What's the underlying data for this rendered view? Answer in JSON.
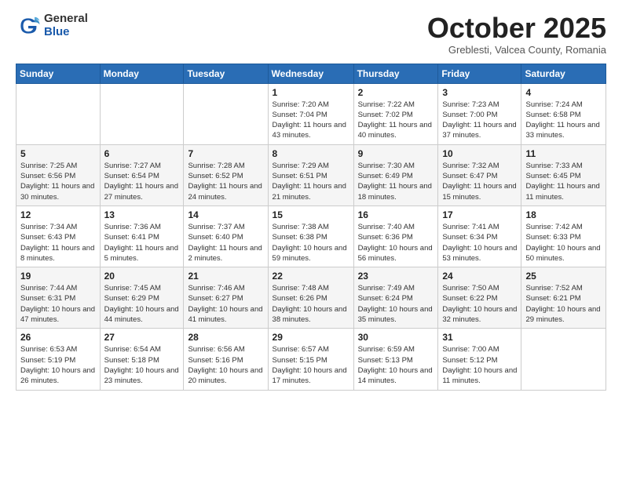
{
  "header": {
    "logo": {
      "general": "General",
      "blue": "Blue"
    },
    "title": "October 2025",
    "subtitle": "Greblesti, Valcea County, Romania"
  },
  "weekdays": [
    "Sunday",
    "Monday",
    "Tuesday",
    "Wednesday",
    "Thursday",
    "Friday",
    "Saturday"
  ],
  "weeks": [
    [
      {
        "day": null
      },
      {
        "day": null
      },
      {
        "day": null
      },
      {
        "day": 1,
        "sunrise": "Sunrise: 7:20 AM",
        "sunset": "Sunset: 7:04 PM",
        "daylight": "Daylight: 11 hours and 43 minutes."
      },
      {
        "day": 2,
        "sunrise": "Sunrise: 7:22 AM",
        "sunset": "Sunset: 7:02 PM",
        "daylight": "Daylight: 11 hours and 40 minutes."
      },
      {
        "day": 3,
        "sunrise": "Sunrise: 7:23 AM",
        "sunset": "Sunset: 7:00 PM",
        "daylight": "Daylight: 11 hours and 37 minutes."
      },
      {
        "day": 4,
        "sunrise": "Sunrise: 7:24 AM",
        "sunset": "Sunset: 6:58 PM",
        "daylight": "Daylight: 11 hours and 33 minutes."
      }
    ],
    [
      {
        "day": 5,
        "sunrise": "Sunrise: 7:25 AM",
        "sunset": "Sunset: 6:56 PM",
        "daylight": "Daylight: 11 hours and 30 minutes."
      },
      {
        "day": 6,
        "sunrise": "Sunrise: 7:27 AM",
        "sunset": "Sunset: 6:54 PM",
        "daylight": "Daylight: 11 hours and 27 minutes."
      },
      {
        "day": 7,
        "sunrise": "Sunrise: 7:28 AM",
        "sunset": "Sunset: 6:52 PM",
        "daylight": "Daylight: 11 hours and 24 minutes."
      },
      {
        "day": 8,
        "sunrise": "Sunrise: 7:29 AM",
        "sunset": "Sunset: 6:51 PM",
        "daylight": "Daylight: 11 hours and 21 minutes."
      },
      {
        "day": 9,
        "sunrise": "Sunrise: 7:30 AM",
        "sunset": "Sunset: 6:49 PM",
        "daylight": "Daylight: 11 hours and 18 minutes."
      },
      {
        "day": 10,
        "sunrise": "Sunrise: 7:32 AM",
        "sunset": "Sunset: 6:47 PM",
        "daylight": "Daylight: 11 hours and 15 minutes."
      },
      {
        "day": 11,
        "sunrise": "Sunrise: 7:33 AM",
        "sunset": "Sunset: 6:45 PM",
        "daylight": "Daylight: 11 hours and 11 minutes."
      }
    ],
    [
      {
        "day": 12,
        "sunrise": "Sunrise: 7:34 AM",
        "sunset": "Sunset: 6:43 PM",
        "daylight": "Daylight: 11 hours and 8 minutes."
      },
      {
        "day": 13,
        "sunrise": "Sunrise: 7:36 AM",
        "sunset": "Sunset: 6:41 PM",
        "daylight": "Daylight: 11 hours and 5 minutes."
      },
      {
        "day": 14,
        "sunrise": "Sunrise: 7:37 AM",
        "sunset": "Sunset: 6:40 PM",
        "daylight": "Daylight: 11 hours and 2 minutes."
      },
      {
        "day": 15,
        "sunrise": "Sunrise: 7:38 AM",
        "sunset": "Sunset: 6:38 PM",
        "daylight": "Daylight: 10 hours and 59 minutes."
      },
      {
        "day": 16,
        "sunrise": "Sunrise: 7:40 AM",
        "sunset": "Sunset: 6:36 PM",
        "daylight": "Daylight: 10 hours and 56 minutes."
      },
      {
        "day": 17,
        "sunrise": "Sunrise: 7:41 AM",
        "sunset": "Sunset: 6:34 PM",
        "daylight": "Daylight: 10 hours and 53 minutes."
      },
      {
        "day": 18,
        "sunrise": "Sunrise: 7:42 AM",
        "sunset": "Sunset: 6:33 PM",
        "daylight": "Daylight: 10 hours and 50 minutes."
      }
    ],
    [
      {
        "day": 19,
        "sunrise": "Sunrise: 7:44 AM",
        "sunset": "Sunset: 6:31 PM",
        "daylight": "Daylight: 10 hours and 47 minutes."
      },
      {
        "day": 20,
        "sunrise": "Sunrise: 7:45 AM",
        "sunset": "Sunset: 6:29 PM",
        "daylight": "Daylight: 10 hours and 44 minutes."
      },
      {
        "day": 21,
        "sunrise": "Sunrise: 7:46 AM",
        "sunset": "Sunset: 6:27 PM",
        "daylight": "Daylight: 10 hours and 41 minutes."
      },
      {
        "day": 22,
        "sunrise": "Sunrise: 7:48 AM",
        "sunset": "Sunset: 6:26 PM",
        "daylight": "Daylight: 10 hours and 38 minutes."
      },
      {
        "day": 23,
        "sunrise": "Sunrise: 7:49 AM",
        "sunset": "Sunset: 6:24 PM",
        "daylight": "Daylight: 10 hours and 35 minutes."
      },
      {
        "day": 24,
        "sunrise": "Sunrise: 7:50 AM",
        "sunset": "Sunset: 6:22 PM",
        "daylight": "Daylight: 10 hours and 32 minutes."
      },
      {
        "day": 25,
        "sunrise": "Sunrise: 7:52 AM",
        "sunset": "Sunset: 6:21 PM",
        "daylight": "Daylight: 10 hours and 29 minutes."
      }
    ],
    [
      {
        "day": 26,
        "sunrise": "Sunrise: 6:53 AM",
        "sunset": "Sunset: 5:19 PM",
        "daylight": "Daylight: 10 hours and 26 minutes."
      },
      {
        "day": 27,
        "sunrise": "Sunrise: 6:54 AM",
        "sunset": "Sunset: 5:18 PM",
        "daylight": "Daylight: 10 hours and 23 minutes."
      },
      {
        "day": 28,
        "sunrise": "Sunrise: 6:56 AM",
        "sunset": "Sunset: 5:16 PM",
        "daylight": "Daylight: 10 hours and 20 minutes."
      },
      {
        "day": 29,
        "sunrise": "Sunrise: 6:57 AM",
        "sunset": "Sunset: 5:15 PM",
        "daylight": "Daylight: 10 hours and 17 minutes."
      },
      {
        "day": 30,
        "sunrise": "Sunrise: 6:59 AM",
        "sunset": "Sunset: 5:13 PM",
        "daylight": "Daylight: 10 hours and 14 minutes."
      },
      {
        "day": 31,
        "sunrise": "Sunrise: 7:00 AM",
        "sunset": "Sunset: 5:12 PM",
        "daylight": "Daylight: 10 hours and 11 minutes."
      },
      {
        "day": null
      }
    ]
  ]
}
